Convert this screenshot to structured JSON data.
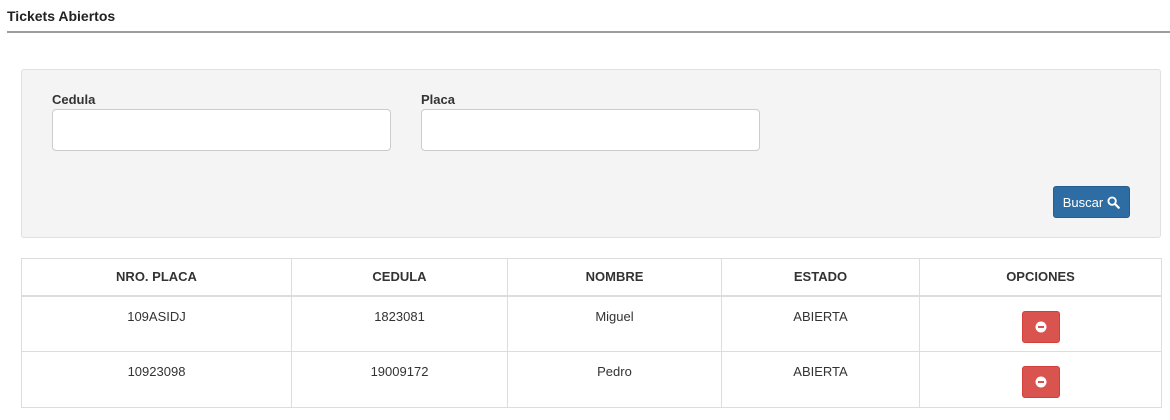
{
  "header": {
    "title": "Tickets Abiertos"
  },
  "search_form": {
    "cedula_label": "Cedula",
    "cedula_value": "",
    "placa_label": "Placa",
    "placa_value": "",
    "search_button_label": "Buscar",
    "search_button_icon": "search-icon"
  },
  "table": {
    "columns": [
      "NRO. PLACA",
      "CEDULA",
      "NOMBRE",
      "ESTADO",
      "OPCIONES"
    ],
    "rows": [
      {
        "placa": "109ASIDJ",
        "cedula": "1823081",
        "nombre": "Miguel",
        "estado": "ABIERTA",
        "option_icon": "minus-circle-icon"
      },
      {
        "placa": "10923098",
        "cedula": "19009172",
        "nombre": "Pedro",
        "estado": "ABIERTA",
        "option_icon": "minus-circle-icon"
      }
    ]
  },
  "colors": {
    "primary_button": "#2e6da4",
    "danger_button": "#d9534f",
    "panel_background": "#f4f4f4"
  }
}
